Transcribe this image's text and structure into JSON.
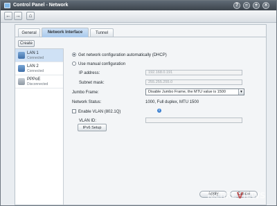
{
  "window": {
    "title": "Control Panel - Network"
  },
  "toolbar": {
    "back": "←",
    "forward": "→",
    "home": "⌂"
  },
  "titlebar_buttons": {
    "help": "?",
    "minimize": "–",
    "maximize": "+",
    "close": "×"
  },
  "tabs": [
    {
      "label": "General",
      "active": false
    },
    {
      "label": "Network Interface",
      "active": true
    },
    {
      "label": "Tunnel",
      "active": false
    }
  ],
  "create_label": "Create",
  "interfaces": [
    {
      "name": "LAN 1",
      "status": "Connected",
      "selected": true,
      "icon": "ethernet-icon"
    },
    {
      "name": "LAN 2",
      "status": "Connected",
      "selected": false,
      "icon": "ethernet-icon"
    },
    {
      "name": "PPPoE",
      "status": "Disconnected",
      "selected": false,
      "icon": "pppoe-icon"
    }
  ],
  "form": {
    "dhcp_label": "Get network configuration automatically (DHCP)",
    "manual_label": "Use manual configuration",
    "ip_label": "IP address:",
    "ip_value": "192.168.0.191",
    "subnet_label": "Subnet mask:",
    "subnet_value": "255.255.255.0",
    "jumbo_label": "Jumbo Frame:",
    "jumbo_value": "Disable Jumbo Frame, the MTU value is 1500",
    "status_label": "Network Status:",
    "status_value": "1000, Full duplex, MTU 1500",
    "vlan_label": "Enable VLAN (802.1Q)",
    "vlan_id_label": "VLAN ID:",
    "vlan_id_value": "",
    "ipv6_label": "IPv6 Setup"
  },
  "footer": {
    "apply": "Apply",
    "cancel": "Cancel"
  },
  "watermark": {
    "part1": "TechRE",
    "part2": "V",
    "part3": "IEWS"
  },
  "colors": {
    "accent": "#a9c9ec",
    "selected_row": "#cfe1f5"
  }
}
